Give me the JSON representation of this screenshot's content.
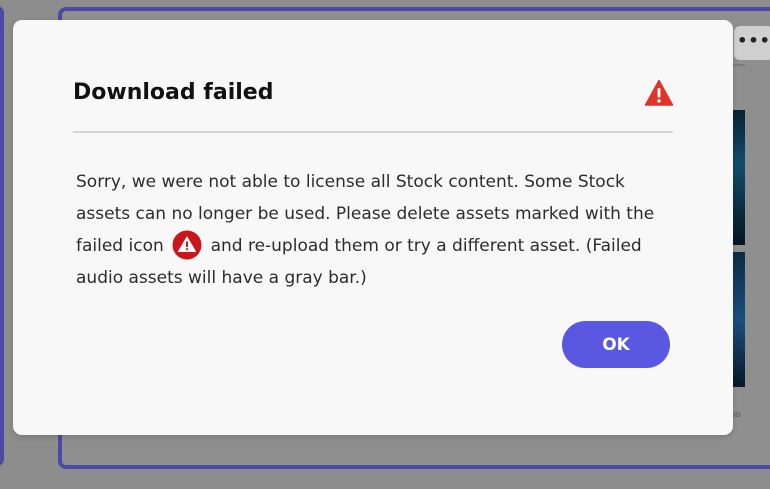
{
  "background": {
    "more_button_label": "•••",
    "thumbnail_caption": "NG"
  },
  "dialog": {
    "title": "Download failed",
    "title_icon": "alert-triangle-icon",
    "body_part1": "Sorry, we were not able to license all Stock content. Some Stock assets can no longer be used. Please delete assets marked with the failed icon",
    "body_icon": "failed-circle-alert-icon",
    "body_part2": "and re-upload them or try a different asset. (Failed audio assets will have a gray bar.)",
    "ok_label": "OK"
  },
  "colors": {
    "accent": "#5a57e0",
    "alert_red": "#e0342a",
    "failed_icon_red": "#c8161c",
    "frame_purple": "#4b4aa6",
    "dialog_bg": "#f8f8f8"
  }
}
